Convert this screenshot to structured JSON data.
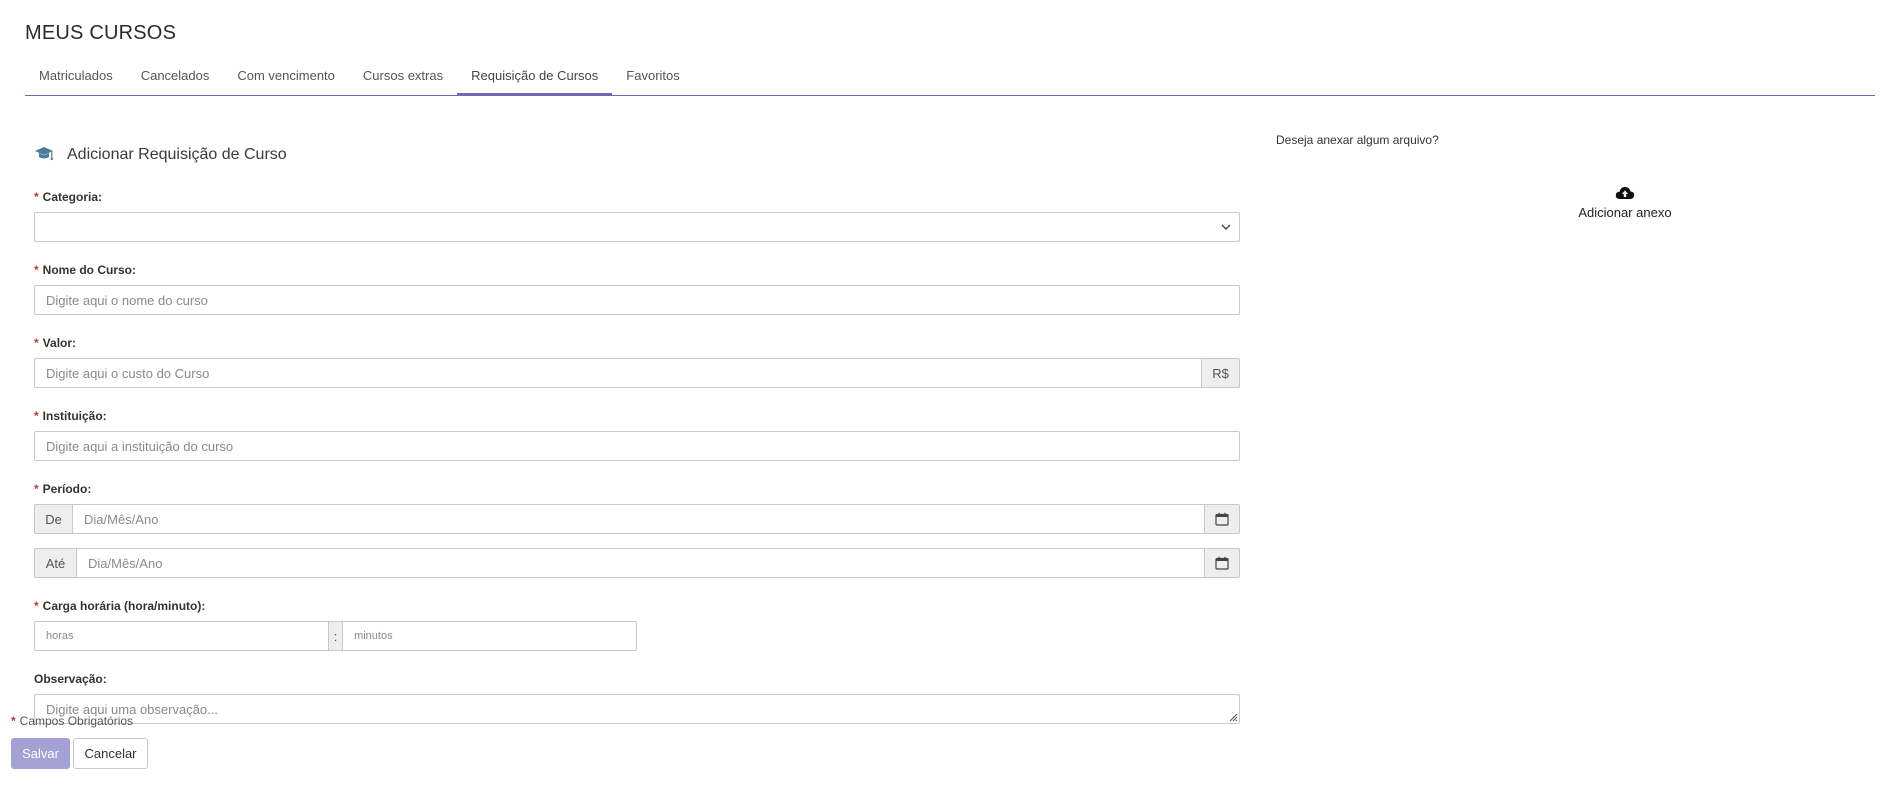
{
  "page": {
    "title": "MEUS CURSOS"
  },
  "tabs": [
    {
      "label": "Matriculados"
    },
    {
      "label": "Cancelados"
    },
    {
      "label": "Com vencimento"
    },
    {
      "label": "Cursos extras"
    },
    {
      "label": "Requisição de Cursos",
      "active": true
    },
    {
      "label": "Favoritos"
    }
  ],
  "form": {
    "title": "Adicionar Requisição de Curso",
    "icon": "graduation-cap-icon",
    "required_mark": "*",
    "categoria": {
      "label": "Categoria:",
      "value": ""
    },
    "nome": {
      "label": "Nome do Curso:",
      "placeholder": "Digite aqui o nome do curso"
    },
    "valor": {
      "label": "Valor:",
      "placeholder": "Digite aqui o custo do Curso",
      "addon": "R$"
    },
    "instituicao": {
      "label": "Instituição:",
      "placeholder": "Digite aqui a instituição do curso"
    },
    "periodo": {
      "label": "Período:",
      "de_label": "De",
      "ate_label": "Até",
      "placeholder": "Dia/Mês/Ano"
    },
    "carga": {
      "label": "Carga horária (hora/minuto):",
      "hours_placeholder": "horas",
      "separator": ":",
      "minutes_placeholder": "minutos"
    },
    "observacao": {
      "label": "Observação:",
      "placeholder": "Digite aqui uma observação..."
    },
    "required_note": "Campos Obrigatórios",
    "save_label": "Salvar",
    "cancel_label": "Cancelar"
  },
  "attachment": {
    "question": "Deseja anexar algum arquivo?",
    "add_label": "Adicionar anexo",
    "icon": "cloud-upload-icon"
  },
  "colors": {
    "accent": "#6d6ab8",
    "save_button": "#a4a1d4",
    "required": "#c0392b",
    "icon": "#4a7b9d"
  }
}
